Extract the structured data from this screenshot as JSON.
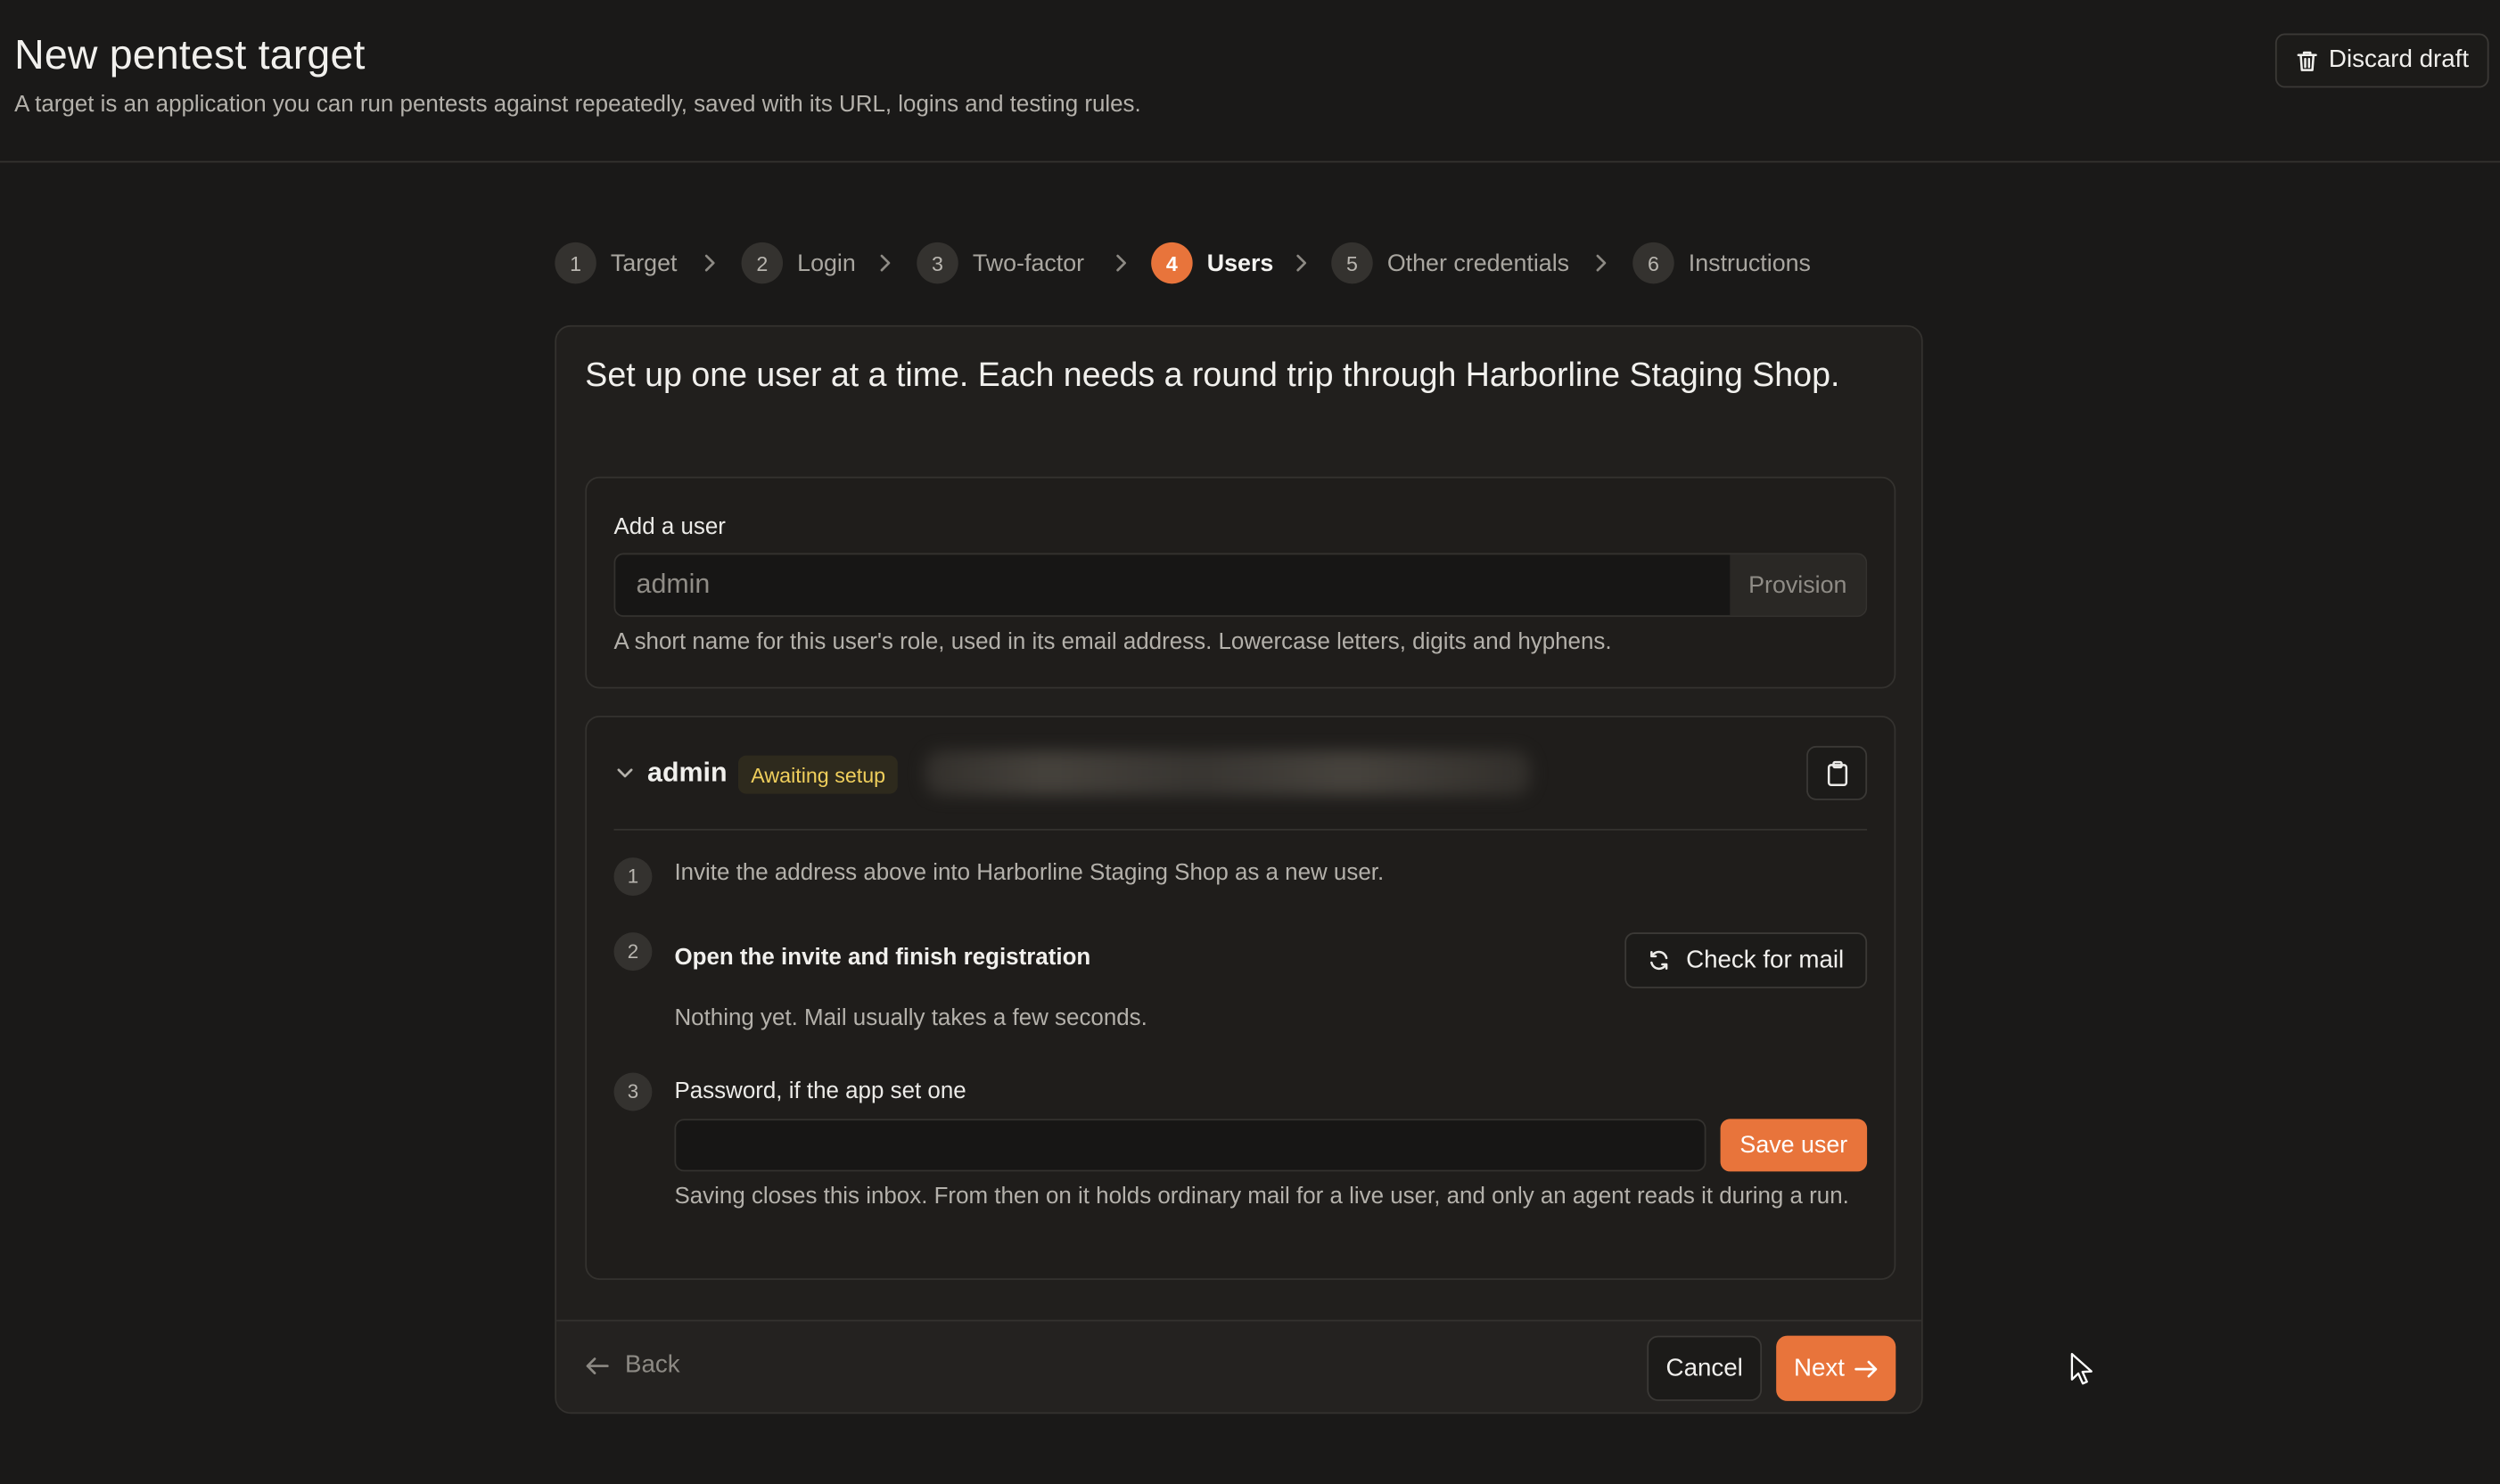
{
  "header": {
    "title": "New pentest target",
    "subtitle": "A target is an application you can run pentests against repeatedly, saved with its URL, logins and testing rules.",
    "discard_label": "Discard draft"
  },
  "stepper": {
    "steps": [
      {
        "num": "1",
        "label": "Target"
      },
      {
        "num": "2",
        "label": "Login"
      },
      {
        "num": "3",
        "label": "Two-factor"
      },
      {
        "num": "4",
        "label": "Users",
        "active": true
      },
      {
        "num": "5",
        "label": "Other credentials"
      },
      {
        "num": "6",
        "label": "Instructions"
      }
    ]
  },
  "card": {
    "heading": "Set up one user at a time. Each needs a round trip through Harborline Staging Shop.",
    "add_user": {
      "label": "Add a user",
      "placeholder": "admin",
      "value": "",
      "provision_label": "Provision",
      "hint": "A short name for this user's role, used in its email address. Lowercase letters, digits and hyphens."
    },
    "user": {
      "name": "admin",
      "status": "Awaiting setup",
      "steps": [
        {
          "num": "1",
          "text": "Invite the address above into Harborline Staging Shop as a new user."
        },
        {
          "num": "2",
          "title": "Open the invite and finish registration",
          "status": "Nothing yet. Mail usually takes a few seconds.",
          "button": "Check for mail"
        },
        {
          "num": "3",
          "title": "Password, if the app set one",
          "value": "",
          "button": "Save user",
          "note": "Saving closes this inbox. From then on it holds ordinary mail for a live user, and only an agent reads it during a run."
        }
      ]
    },
    "footer": {
      "back_label": "Back",
      "cancel_label": "Cancel",
      "next_label": "Next"
    }
  },
  "colors": {
    "background": "#1a1918",
    "accent": "#e8743b",
    "badge_text": "#f0cf5c"
  },
  "icons": [
    "trash-icon",
    "chevron-right-icon",
    "chevron-down-icon",
    "clipboard-icon",
    "refresh-icon",
    "arrow-left-icon",
    "arrow-right-icon",
    "mouse-cursor-icon"
  ]
}
